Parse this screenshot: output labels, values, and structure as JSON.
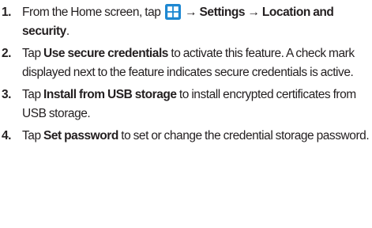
{
  "steps": [
    {
      "number": "1.",
      "t1": "From the Home screen, tap ",
      "arrow1": "→",
      "b1": "Settings",
      "arrow2": "→",
      "b2": "Location and security",
      "t2": "."
    },
    {
      "number": "2.",
      "t1": "Tap ",
      "b1": "Use secure credentials",
      "t2": " to activate this feature. A check mark displayed next to the feature indicates secure credentials is active."
    },
    {
      "number": "3.",
      "t1": "Tap ",
      "b1": "Install from USB storage",
      "t2": " to install encrypted certificates from USB storage."
    },
    {
      "number": "4.",
      "t1": "Tap ",
      "b1": "Set password",
      "t2": " to set or change the credential storage password."
    }
  ],
  "icons": {
    "applications": "applications-grid-icon"
  },
  "colors": {
    "text": "#231f20",
    "icon_bg": "#1e88d2"
  }
}
